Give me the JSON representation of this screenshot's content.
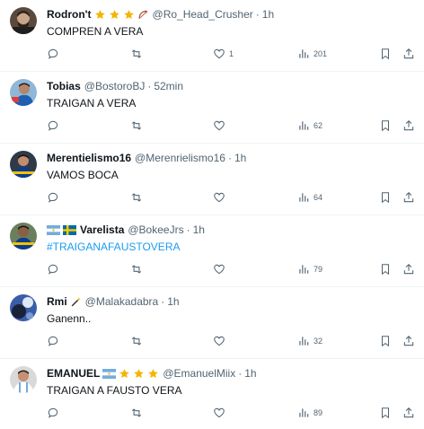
{
  "colors": {
    "text": "#0f1419",
    "muted": "#536471",
    "link": "#1d9bf0",
    "divider": "#eff3f4"
  },
  "icons": {
    "reply": "reply-icon",
    "retweet": "retweet-icon",
    "like": "like-icon",
    "views": "views-icon",
    "bookmark": "bookmark-icon",
    "share": "share-icon"
  },
  "tweets": [
    {
      "name": "Rodron't",
      "handle": "@Ro_Head_Crusher",
      "sep": "·",
      "time": "1h",
      "text": "COMPREN A VERA",
      "likes": "1",
      "views": "201",
      "emojis": [
        "star",
        "star",
        "star",
        "bow-arrow"
      ]
    },
    {
      "name": "Tobias",
      "handle": "@BostoroBJ",
      "sep": "·",
      "time": "52min",
      "text": "TRAIGAN A VERA",
      "likes": "",
      "views": "62",
      "emojis": []
    },
    {
      "name": "Merentielismo16",
      "handle": "@Merenrielismo16",
      "sep": "·",
      "time": "1h",
      "text": "VAMOS BOCA",
      "likes": "",
      "views": "64",
      "emojis": []
    },
    {
      "name": "Varelista",
      "handle": "@BokeeJrs",
      "sep": "·",
      "time": "1h",
      "text": "#TRAIGANAFAUSTOVERA",
      "likes": "",
      "views": "79",
      "emojis": [
        "flag-argentina",
        "flag-sweden"
      ]
    },
    {
      "name": "Rmi",
      "handle": "@Malakadabra",
      "sep": "·",
      "time": "1h",
      "text": "Ganenn..",
      "likes": "",
      "views": "32",
      "emojis": [
        "magic-wand"
      ]
    },
    {
      "name": "EMANUEL",
      "handle": "@EmanuelMiix",
      "sep": "·",
      "time": "1h",
      "text": "TRAIGAN A FAUSTO VERA",
      "likes": "",
      "views": "89",
      "emojis": [
        "flag-argentina",
        "star",
        "star",
        "star"
      ]
    }
  ]
}
